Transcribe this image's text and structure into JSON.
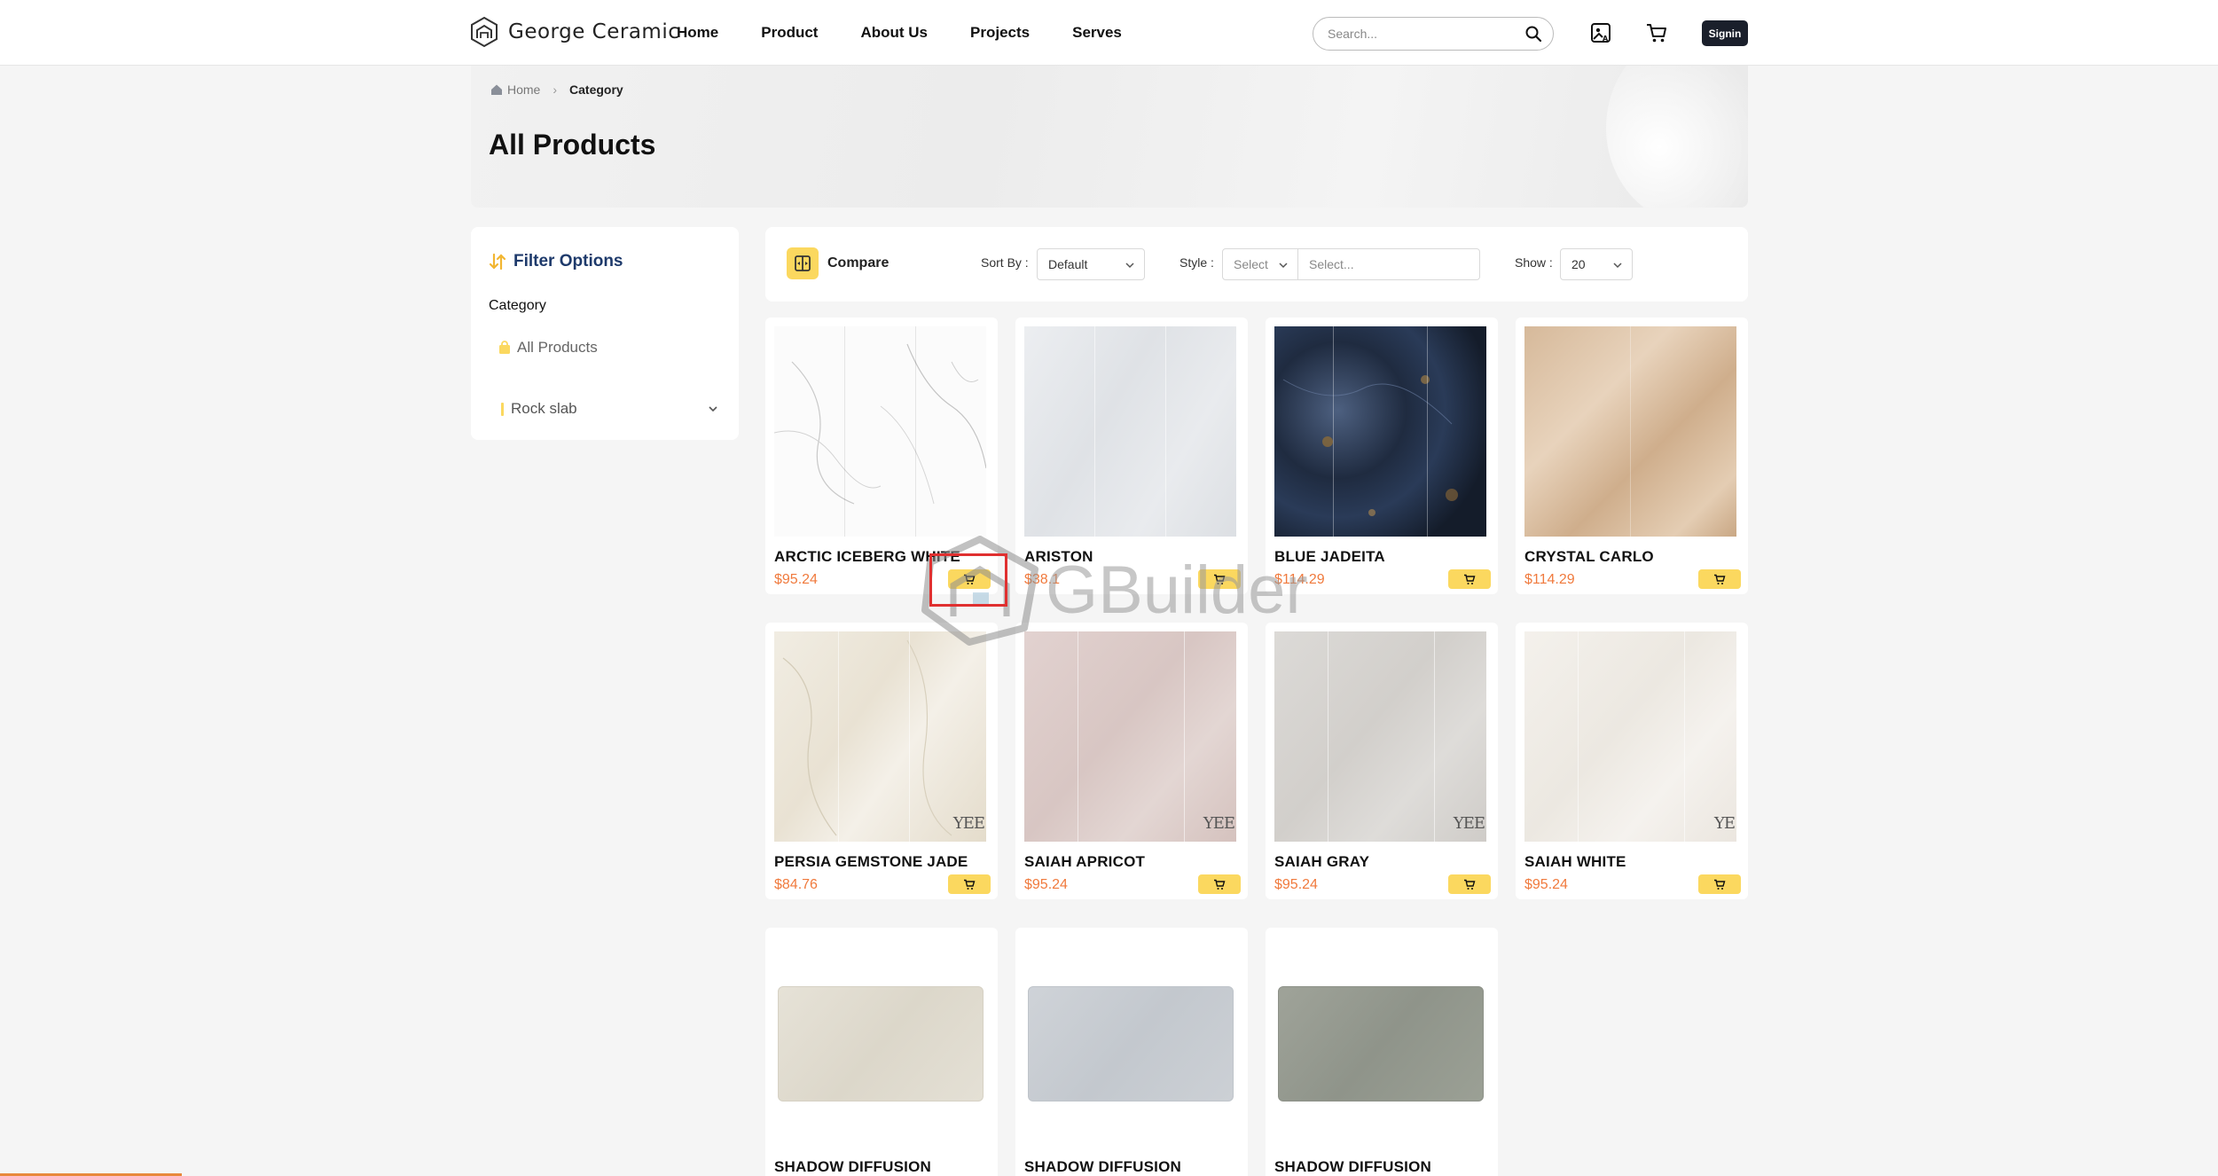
{
  "header": {
    "brand": "George Ceramic",
    "nav": [
      "Home",
      "Product",
      "About Us",
      "Projects",
      "Serves"
    ],
    "search_placeholder": "Search...",
    "signin_label": "Signin"
  },
  "breadcrumb": {
    "home": "Home",
    "current": "Category"
  },
  "page_title": "All Products",
  "filter": {
    "title": "Filter Options",
    "category_label": "Category",
    "items": [
      "All Products",
      "Rock slab"
    ]
  },
  "toolbar": {
    "compare_label": "Compare",
    "sort_label": "Sort By :",
    "sort_value": "Default",
    "style_label": "Style :",
    "style_value": "Select",
    "style_sub_placeholder": "Select...",
    "show_label": "Show :",
    "show_value": "20"
  },
  "products": [
    {
      "name": "ARCTIC ICEBERG WHITE",
      "price": "$95.24"
    },
    {
      "name": "ARISTON",
      "price": "$38.1"
    },
    {
      "name": "BLUE JADEITA",
      "price": "$114.29"
    },
    {
      "name": "CRYSTAL CARLO",
      "price": "$114.29"
    },
    {
      "name": "PERSIA GEMSTONE JADE",
      "price": "$84.76"
    },
    {
      "name": "SAIAH APRICOT",
      "price": "$95.24"
    },
    {
      "name": "SAIAH GRAY",
      "price": "$95.24"
    },
    {
      "name": "SAIAH WHITE",
      "price": "$95.24"
    },
    {
      "name": "SHADOW DIFFUSION",
      "price": ""
    },
    {
      "name": "SHADOW DIFFUSION",
      "price": ""
    },
    {
      "name": "SHADOW DIFFUSION",
      "price": ""
    }
  ],
  "watermark": "GBuilder",
  "colors": {
    "accent": "#fbd85f",
    "price": "#f07a3d",
    "filter_title": "#1e3a6b",
    "signin_bg": "#1a1f2b"
  }
}
